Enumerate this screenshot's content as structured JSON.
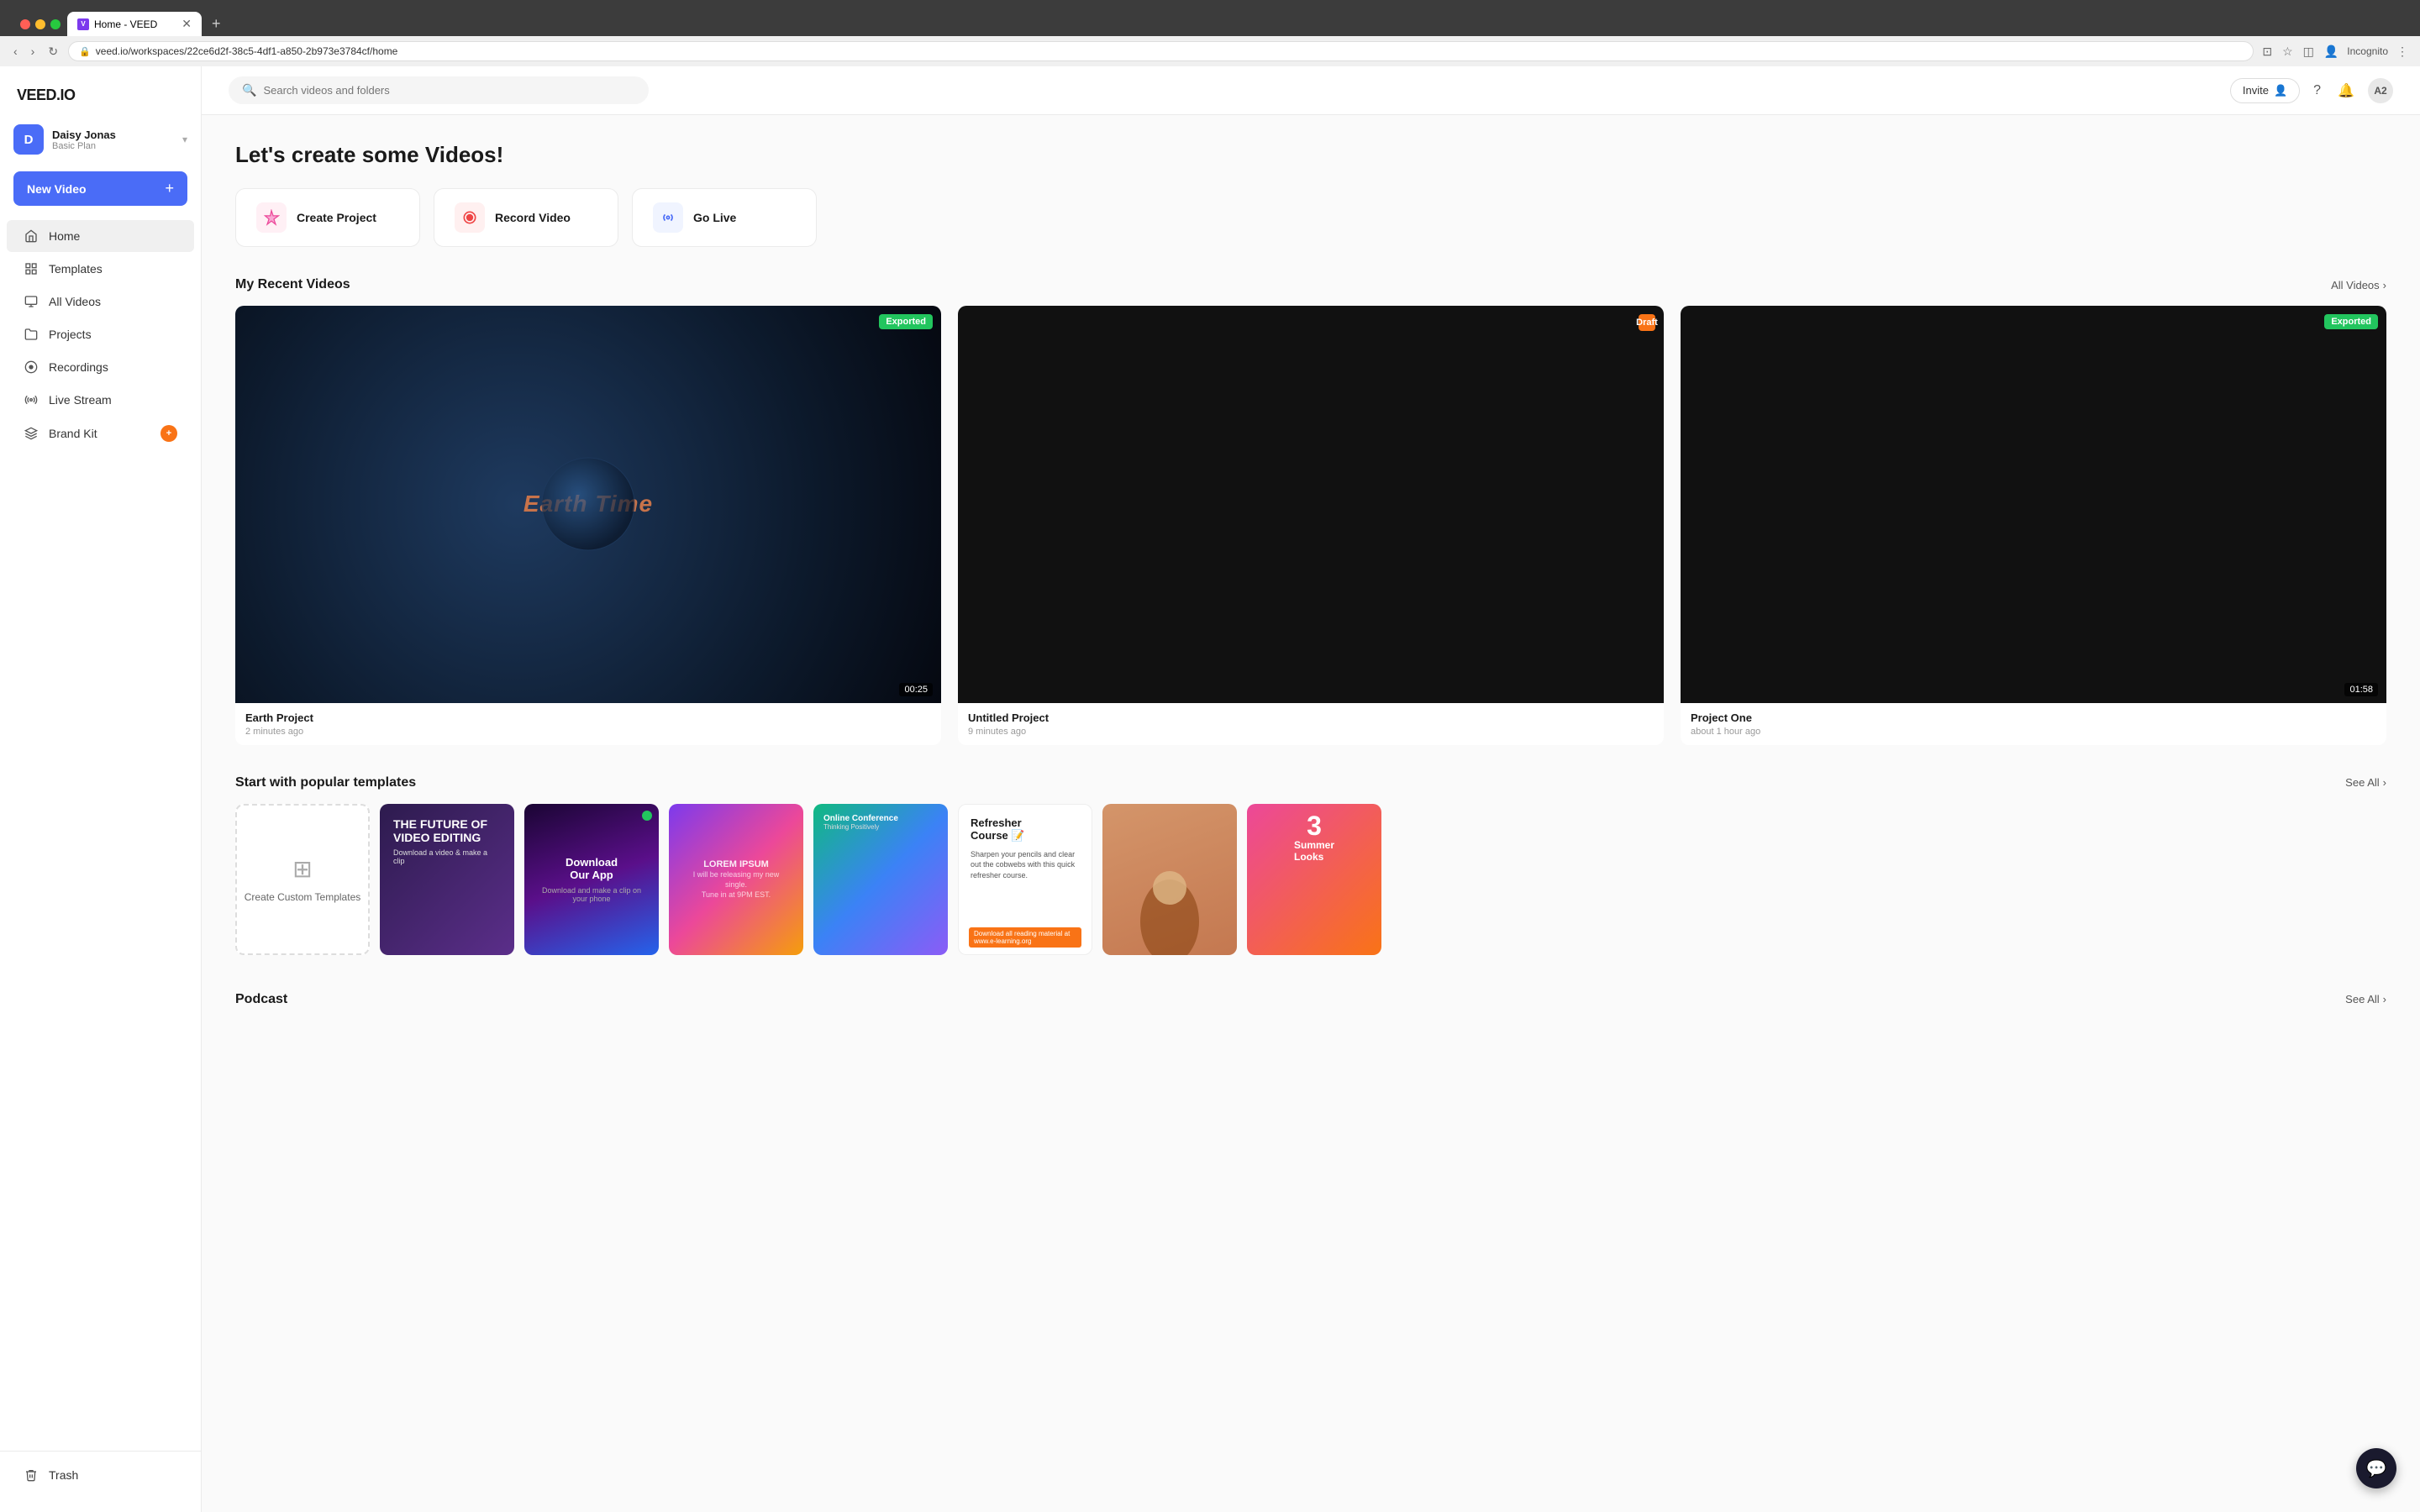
{
  "browser": {
    "tab_title": "Home - VEED",
    "tab_favicon": "V",
    "url": "veed.io/workspaces/22ce6d2f-38c5-4df1-a850-2b973e3784cf/home",
    "profile": "Incognito",
    "new_tab_label": "+"
  },
  "header": {
    "search_placeholder": "Search videos and folders",
    "invite_label": "Invite",
    "avatar_initials": "A2"
  },
  "sidebar": {
    "logo": "VEED.IO",
    "user": {
      "initial": "D",
      "name": "Daisy Jonas",
      "plan": "Basic Plan"
    },
    "new_video_label": "New Video",
    "nav_items": [
      {
        "id": "home",
        "label": "Home",
        "icon": "home"
      },
      {
        "id": "templates",
        "label": "Templates",
        "icon": "templates"
      },
      {
        "id": "all-videos",
        "label": "All Videos",
        "icon": "videos"
      },
      {
        "id": "projects",
        "label": "Projects",
        "icon": "projects"
      },
      {
        "id": "recordings",
        "label": "Recordings",
        "icon": "recordings"
      },
      {
        "id": "live-stream",
        "label": "Live Stream",
        "icon": "live"
      },
      {
        "id": "brand-kit",
        "label": "Brand Kit",
        "icon": "brand",
        "badge": "+"
      }
    ],
    "trash_label": "Trash"
  },
  "main": {
    "page_title_prefix": "Let's create some ",
    "page_title_bold": "Videos!",
    "action_cards": [
      {
        "id": "create-project",
        "label": "Create Project",
        "icon": "✦"
      },
      {
        "id": "record-video",
        "label": "Record Video",
        "icon": "⏺"
      },
      {
        "id": "go-live",
        "label": "Go Live",
        "icon": "📡"
      }
    ],
    "recent_videos": {
      "title": "My Recent Videos",
      "see_all": "All Videos",
      "videos": [
        {
          "id": "earth-project",
          "title": "Earth Project",
          "time": "2 minutes ago",
          "badge": "Exported",
          "badge_type": "green",
          "duration": "00:25",
          "type": "earth"
        },
        {
          "id": "untitled-project",
          "title": "Untitled Project",
          "time": "9 minutes ago",
          "badge": "Draft",
          "badge_type": "orange",
          "duration": "",
          "type": "dark"
        },
        {
          "id": "project-one",
          "title": "Project One",
          "time": "about 1 hour ago",
          "badge": "Exported",
          "badge_type": "green",
          "duration": "01:58",
          "type": "dark"
        }
      ]
    },
    "templates": {
      "title": "Start with popular templates",
      "see_all": "See All",
      "items": [
        {
          "id": "create-custom",
          "type": "create",
          "label": "Create Custom Templates"
        },
        {
          "id": "future-video",
          "type": "template1",
          "title": "THE FUTURE OF VIDEO EDITING",
          "subtitle": ""
        },
        {
          "id": "download-app",
          "type": "template2",
          "title": "Download Our App",
          "subtitle": ""
        },
        {
          "id": "lorem-ipsum",
          "type": "template3",
          "title": "LOREM IPSUM"
        },
        {
          "id": "online-conf",
          "type": "template4",
          "title": "Online Conference",
          "subtitle": "Thinking Positively"
        },
        {
          "id": "refresher-course",
          "type": "template5",
          "title": "Refresher Course 📝",
          "body": "Sharpen your pencils and clear out the cobwebs with this quick refresher course."
        },
        {
          "id": "summer-looks",
          "type": "template7",
          "title": "3 Summer Looks"
        }
      ]
    },
    "podcast": {
      "title": "Podcast",
      "see_all": "See All"
    }
  }
}
